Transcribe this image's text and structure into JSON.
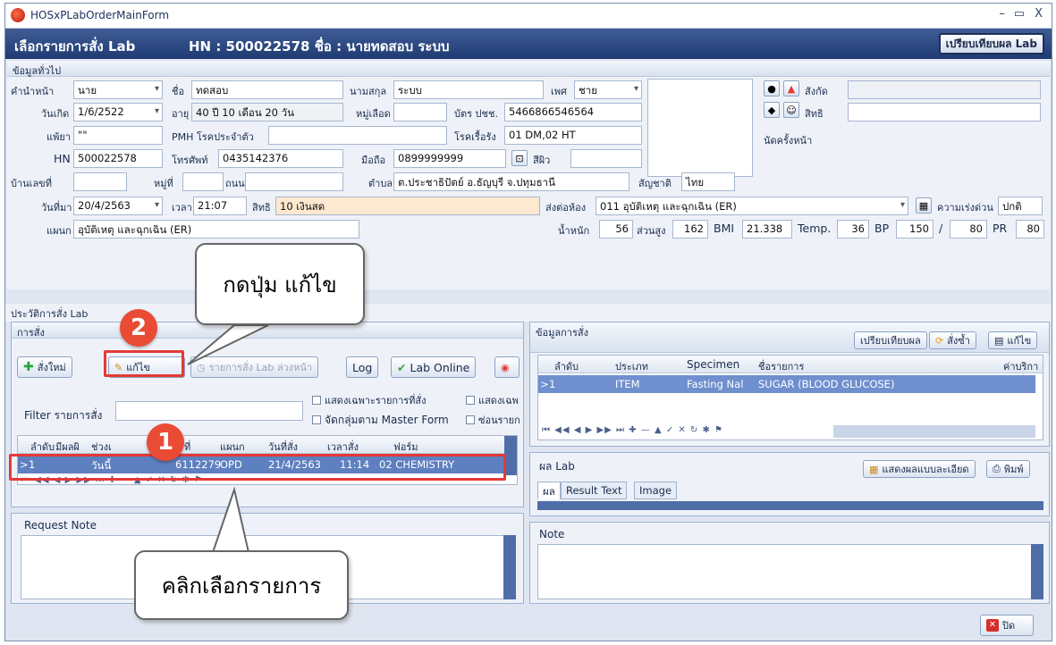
{
  "window": {
    "title": "HOSxPLabOrderMainForm",
    "min": "–",
    "max": "▭",
    "close": "X"
  },
  "header": {
    "title": "เลือกรายการสั่ง Lab",
    "patient": "HN : 500022578 ชื่อ : นายทดสอบ ระบบ",
    "compare_button": "เปรียบเทียบผล Lab"
  },
  "general": {
    "section": "ข้อมูลทั่วไป",
    "prefix_label": "คำนำหน้า",
    "prefix": "นาย",
    "name_label": "ชื่อ",
    "name": "ทดสอบ",
    "surname_label": "นามสกุล",
    "surname": "ระบบ",
    "sex_label": "เพศ",
    "sex": "ชาย",
    "affil_label": "สังกัด",
    "rights_label": "สิทธิ",
    "dob_label": "วันเกิด",
    "dob": "1/6/2522",
    "age_label": "อายุ",
    "age": "40 ปี 10 เดือน 20 วัน",
    "blood_label": "หมู่เลือด",
    "idcard_label": "บัตร ปชช.",
    "idcard": "5466866546564",
    "allergy_label": "แพ้ยา",
    "allergy": "\"\"",
    "pmh_label": "PMH โรคประจำตัว",
    "chronic_label": "โรคเรื้อรัง",
    "chronic": "01 DM,02 HT",
    "nextapp_label": "นัดครั้งหน้า",
    "hn_label": "HN",
    "hn": "500022578",
    "phone_label": "โทรศัพท์",
    "phone": "0435142376",
    "mobile_label": "มือถือ",
    "mobile": "0899999999",
    "skin_label": "สีผิว",
    "house_label": "บ้านเลขที่",
    "moo_label": "หมู่ที่",
    "road_label": "ถนน",
    "tambon_label": "ตำบล",
    "address": "ต.ประชาธิปัตย์ อ.ธัญบุรี จ.ปทุมธานี",
    "nation_label": "สัญชาติ",
    "nation": "ไทย",
    "visit_label": "วันที่มา",
    "visit": "20/4/2563",
    "time_label": "เวลา",
    "time": "21:07",
    "pttype_label": "สิทธิ",
    "pttype": "10 เงินสด",
    "room_label": "ส่งต่อห้อง",
    "room": "011 อุบัติเหตุ และฉุกเฉิน (ER)",
    "urgency_label": "ความเร่งด่วน",
    "urgency": "ปกติ",
    "dept_label": "แผนก",
    "dept": "อุบัติเหตุ และฉุกเฉิน (ER)",
    "weight_label": "น้ำหนัก",
    "weight": "56",
    "height_label": "ส่วนสูง",
    "height": "162",
    "bmi_label": "BMI",
    "bmi": "21.338",
    "temp_label": "Temp.",
    "temp": "36",
    "bp_label": "BP",
    "bp_sys": "150",
    "bp_sep": "/",
    "bp_dia": "80",
    "pr_label": "PR",
    "pr": "80"
  },
  "history": {
    "section": "ประวัติการสั่ง Lab"
  },
  "orders": {
    "section": "การสั่ง",
    "new_button": "สั่งใหม่",
    "edit_button": "แก้ไข",
    "advance_button": "รายการสั่ง Lab ล่วงหน้า",
    "log_button": "Log",
    "online_button": "Lab Online",
    "filter_label": "Filter รายการสั่ง",
    "chk_only": "แสดงเฉพาะรายการที่สั่ง",
    "chk_group": "จัดกลุ่มตาม Master Form",
    "chk_show": "แสดงเฉพ",
    "chk_hide": "ซ่อนรายก",
    "columns": [
      "ลำดับ",
      "มีผลผิ",
      "ช่วงเ",
      "ที่",
      "แผนก",
      "วันที่สั่ง",
      "เวลาสั่ง",
      "ฟอร์ม"
    ],
    "row": {
      "no": "1",
      "range": "วันนี้",
      "num": "6112279",
      "dept": "OPD",
      "date": "21/4/2563",
      "time": "11:14",
      "form": "02 CHEMISTRY"
    }
  },
  "request_note": {
    "label": "Request Note"
  },
  "order_detail": {
    "section": "ข้อมูลการสั่ง",
    "compare_button": "เปรียบเทียบผล",
    "repeat_button": "สั่งซ้ำ",
    "edit_button": "แก้ไข",
    "columns": [
      "ลำดับ",
      "ประเภท",
      "Specimen",
      "ชื่อรายการ",
      "ค่าบริกา"
    ],
    "row": {
      "no": "1",
      "type": "ITEM",
      "specimen": "Fasting Nal",
      "name": "SUGAR (BLOOD GLUCOSE)"
    }
  },
  "lab_result": {
    "section": "ผล Lab",
    "detail_button": "แสดงผลแบบละเอียด",
    "print_button": "พิมพ์",
    "tabs": [
      "ผล",
      "Result Text",
      "Image"
    ]
  },
  "note": {
    "label": "Note"
  },
  "close_button": "ปิด",
  "annotations": {
    "badge1": "1",
    "badge2": "2",
    "callout_edit": "กดปุ่ม แก้ไข",
    "callout_select": "คลิกเลือกรายการ"
  },
  "colors": {
    "header": "#1f3b72",
    "selected_row": "#5e7fc0",
    "annotation": "#e53935"
  }
}
